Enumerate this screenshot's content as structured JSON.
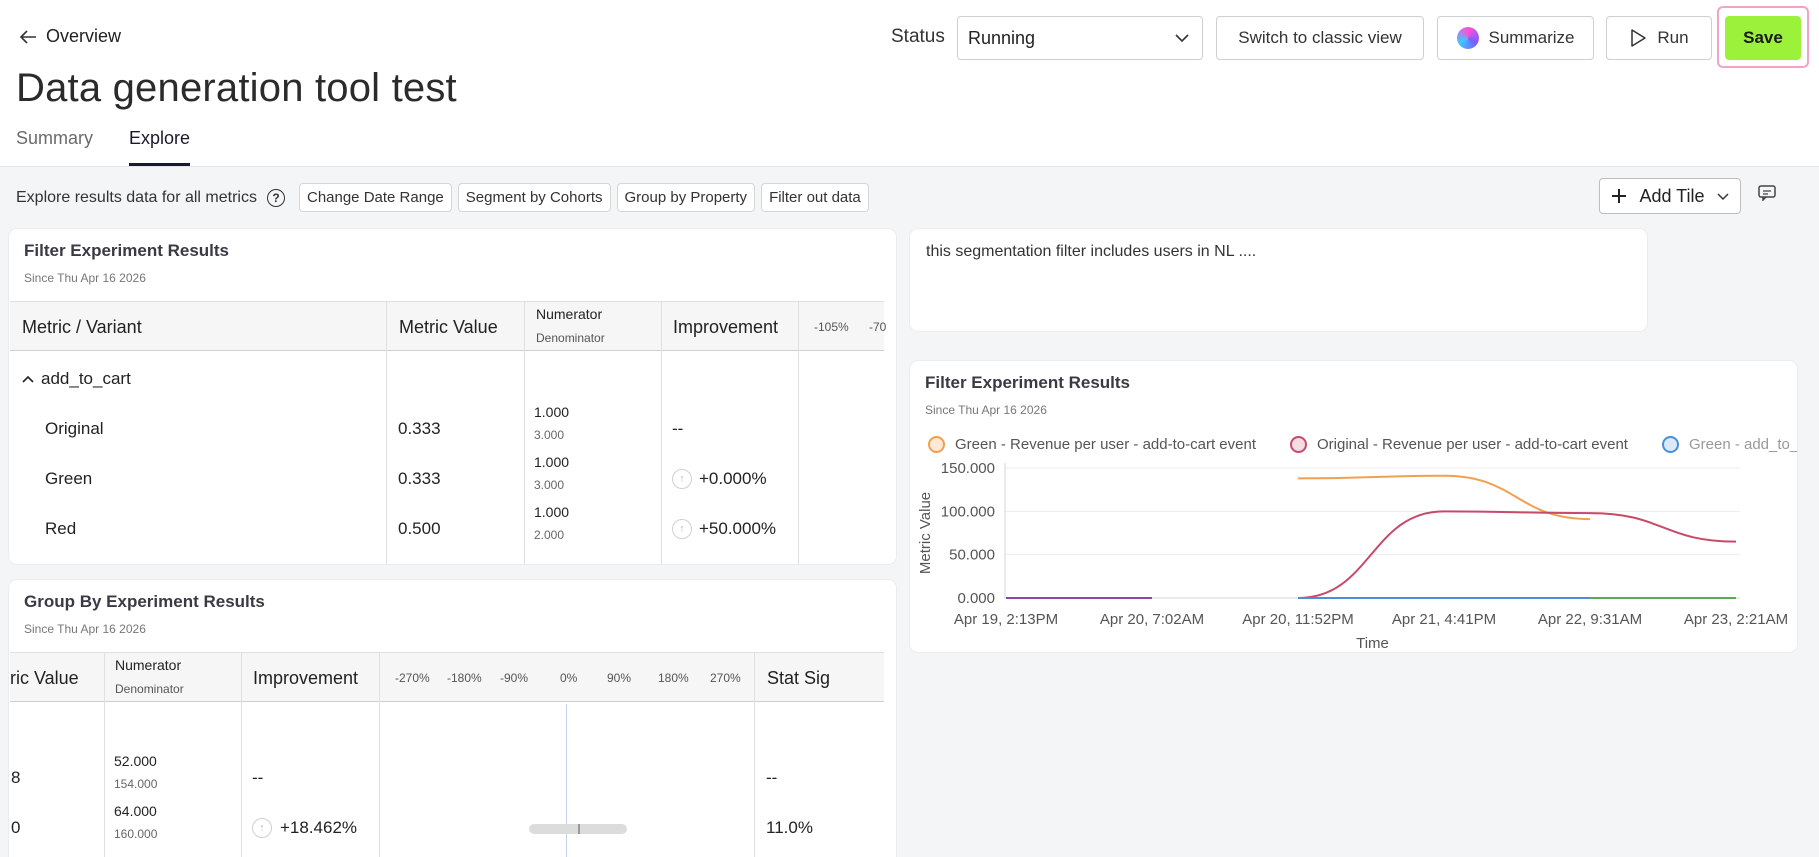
{
  "header": {
    "back_label": "Overview",
    "title": "Data generation tool test",
    "tabs": [
      {
        "label": "Summary",
        "active": false
      },
      {
        "label": "Explore",
        "active": true
      }
    ],
    "status_label": "Status",
    "status_value": "Running",
    "classic_label": "Switch to classic view",
    "summarize_label": "Summarize",
    "run_label": "Run",
    "save_label": "Save",
    "save_color": "#9cf23a"
  },
  "toolbar": {
    "label": "Explore results data for all metrics",
    "chips": [
      "Change Date Range",
      "Segment by Cohorts",
      "Group by Property",
      "Filter out data"
    ],
    "add_tile_label": "Add Tile"
  },
  "filter_card": {
    "title": "Filter Experiment Results",
    "subtitle": "Since Thu Apr 16 2026",
    "headers": {
      "metric": "Metric / Variant",
      "value": "Metric Value",
      "numerator": "Numerator",
      "denominator": "Denominator",
      "improvement": "Improvement",
      "scale_1": "-105%",
      "scale_2": "-70"
    },
    "group_label": "add_to_cart",
    "rows": [
      {
        "variant": "Original",
        "value": "0.333",
        "num": "1.000",
        "den": "3.000",
        "improvement": "--"
      },
      {
        "variant": "Green",
        "value": "0.333",
        "num": "1.000",
        "den": "3.000",
        "improvement": "+0.000%"
      },
      {
        "variant": "Red",
        "value": "0.500",
        "num": "1.000",
        "den": "2.000",
        "improvement": "+50.000%"
      }
    ]
  },
  "groupby_card": {
    "title": "Group By Experiment Results",
    "subtitle": "Since Thu Apr 16 2026",
    "headers": {
      "value": "ric Value",
      "numerator": "Numerator",
      "denominator": "Denominator",
      "improvement": "Improvement",
      "stat_sig": "Stat Sig",
      "scale": [
        "-270%",
        "-180%",
        "-90%",
        "0%",
        "90%",
        "180%",
        "270%"
      ]
    },
    "rows": [
      {
        "value": "8",
        "num": "52.000",
        "den": "154.000",
        "improvement": "--",
        "stat_sig": "--"
      },
      {
        "value": "0",
        "num": "64.000",
        "den": "160.000",
        "improvement": "+18.462%",
        "stat_sig": "11.0%"
      }
    ]
  },
  "note_card": {
    "text": "this segmentation filter includes users in NL ...."
  },
  "chart_card": {
    "title": "Filter Experiment Results",
    "subtitle": "Since Thu Apr 16 2026"
  },
  "chart_data": {
    "type": "line",
    "ylabel": "Metric Value",
    "xlabel": "Time",
    "ylim": [
      0,
      150
    ],
    "yticks": [
      "0.000",
      "50.000",
      "100.000",
      "150.000"
    ],
    "xticks": [
      "Apr 19, 2:13PM",
      "Apr 20, 7:02AM",
      "Apr 20, 11:52PM",
      "Apr 21, 4:41PM",
      "Apr 22, 9:31AM",
      "Apr 23, 2:21AM"
    ],
    "legend_position": "top",
    "legend": [
      {
        "name": "Green - Revenue per user - add-to-cart event",
        "color": "#f0a050"
      },
      {
        "name": "Original - Revenue per user - add-to-cart event",
        "color": "#c84a6a"
      },
      {
        "name": "Green - add_to_",
        "color": "#4a90d9"
      }
    ],
    "series": [
      {
        "color": "#f0a050",
        "points": [
          [
            2,
            138
          ],
          [
            3,
            141
          ],
          [
            4,
            91
          ]
        ]
      },
      {
        "color": "#c84a6a",
        "points": [
          [
            2,
            0
          ],
          [
            3,
            100
          ],
          [
            4,
            98
          ],
          [
            5,
            65
          ]
        ]
      },
      {
        "color": "#8e44ad",
        "points": [
          [
            0,
            0
          ],
          [
            1,
            0
          ]
        ]
      },
      {
        "color": "#4a90d9",
        "points": [
          [
            2,
            0
          ],
          [
            4,
            0
          ]
        ]
      },
      {
        "color": "#5aa85a",
        "points": [
          [
            4,
            0
          ],
          [
            5,
            0
          ]
        ]
      }
    ]
  }
}
